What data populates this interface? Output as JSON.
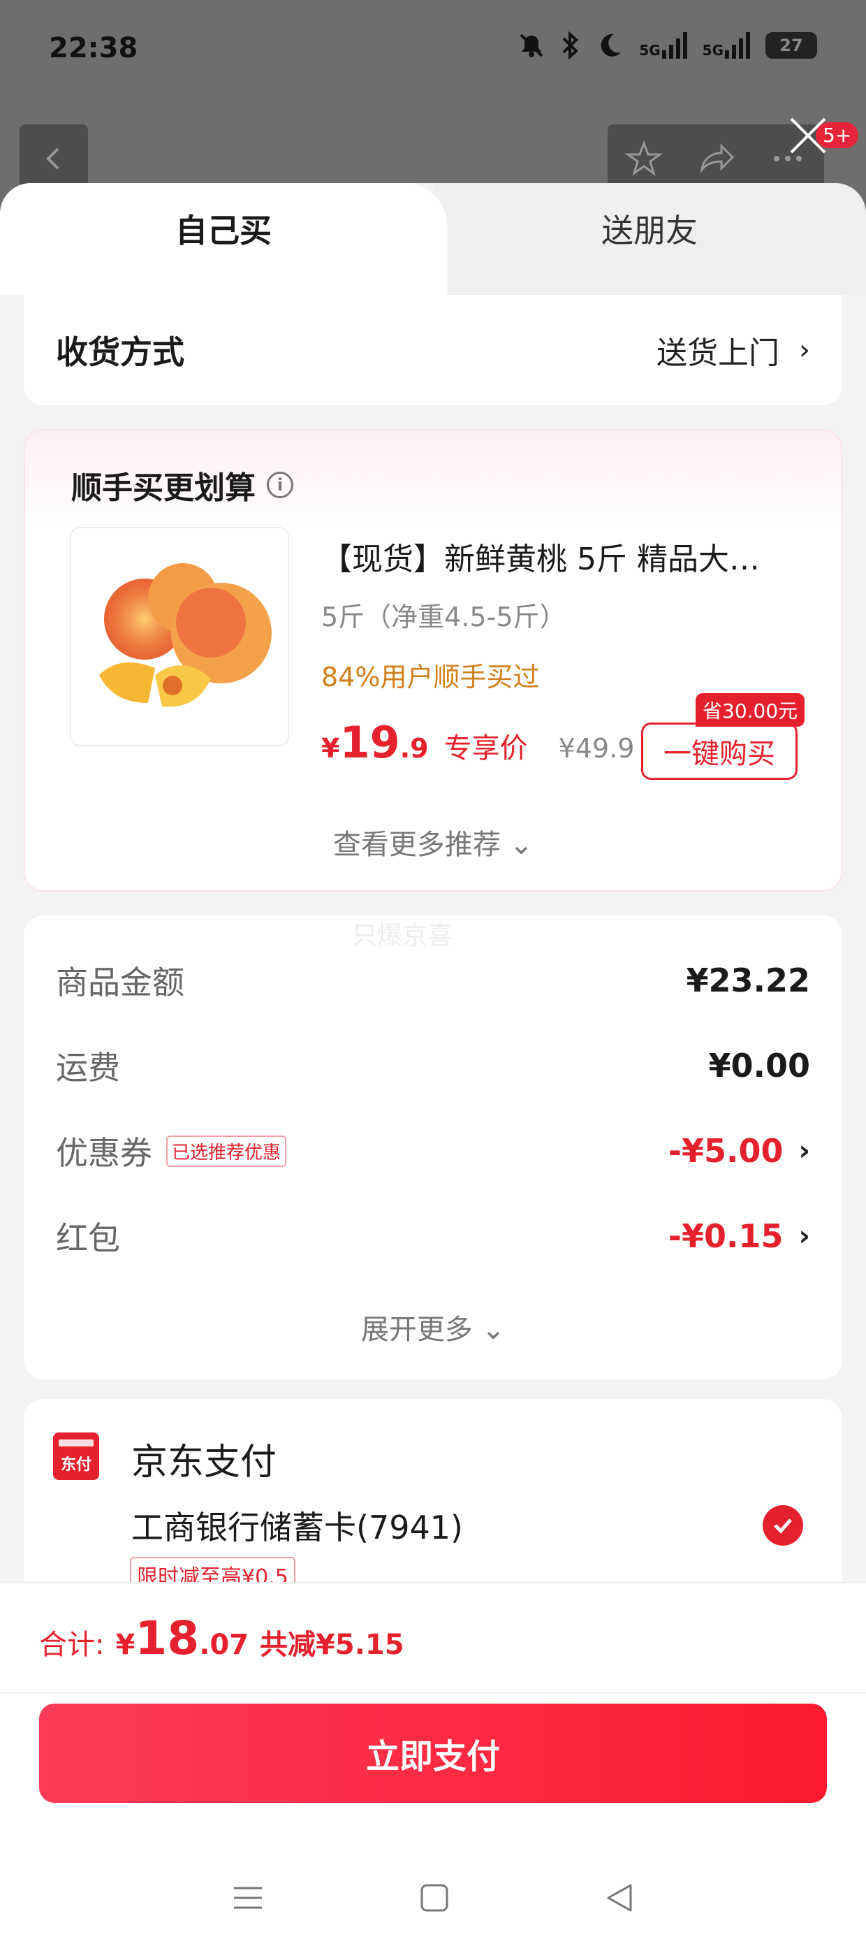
{
  "status_bar": {
    "time": "22:38",
    "signal1": "5G",
    "signal2": "5G",
    "battery": "27"
  },
  "background": {
    "badge": "5+"
  },
  "tabs": {
    "self": "自己买",
    "friend": "送朋友"
  },
  "delivery": {
    "label": "收货方式",
    "value": "送货上门"
  },
  "recommend": {
    "title": "顺手买更划算",
    "product_name": "【现货】新鲜黄桃 5斤 精品大…",
    "spec": "5斤（净重4.5-5斤）",
    "users_text": "84%用户顺手买过",
    "price_yen": "¥",
    "price_int": "19",
    "price_dec": ".9",
    "price_tag": "专享价",
    "orig_price": "¥49.9",
    "save_badge": "省30.00元",
    "buy_button": "一键购买",
    "more": "查看更多推荐"
  },
  "amounts": {
    "watermark": "只爆京喜",
    "rows": [
      {
        "label": "商品金额",
        "value": "¥23.22"
      },
      {
        "label": "运费",
        "value": "¥0.00"
      },
      {
        "label": "优惠券",
        "chip": "已选推荐优惠",
        "value": "-¥5.00"
      },
      {
        "label": "红包",
        "value": "-¥0.15"
      }
    ],
    "expand": "展开更多"
  },
  "payment": {
    "icon_text": "东付",
    "title": "京东支付",
    "bank": "工商银行储蓄卡(7941)",
    "tip": "限时减至高¥0.5"
  },
  "bottom": {
    "total_label": "合计:",
    "total_yen": "¥",
    "total_int": "18",
    "total_dec": ".07",
    "total_cut": "共减¥5.15",
    "pay_button": "立即支付"
  },
  "colors": {
    "accent": "#e4212d",
    "users_text": "#d0801a"
  }
}
